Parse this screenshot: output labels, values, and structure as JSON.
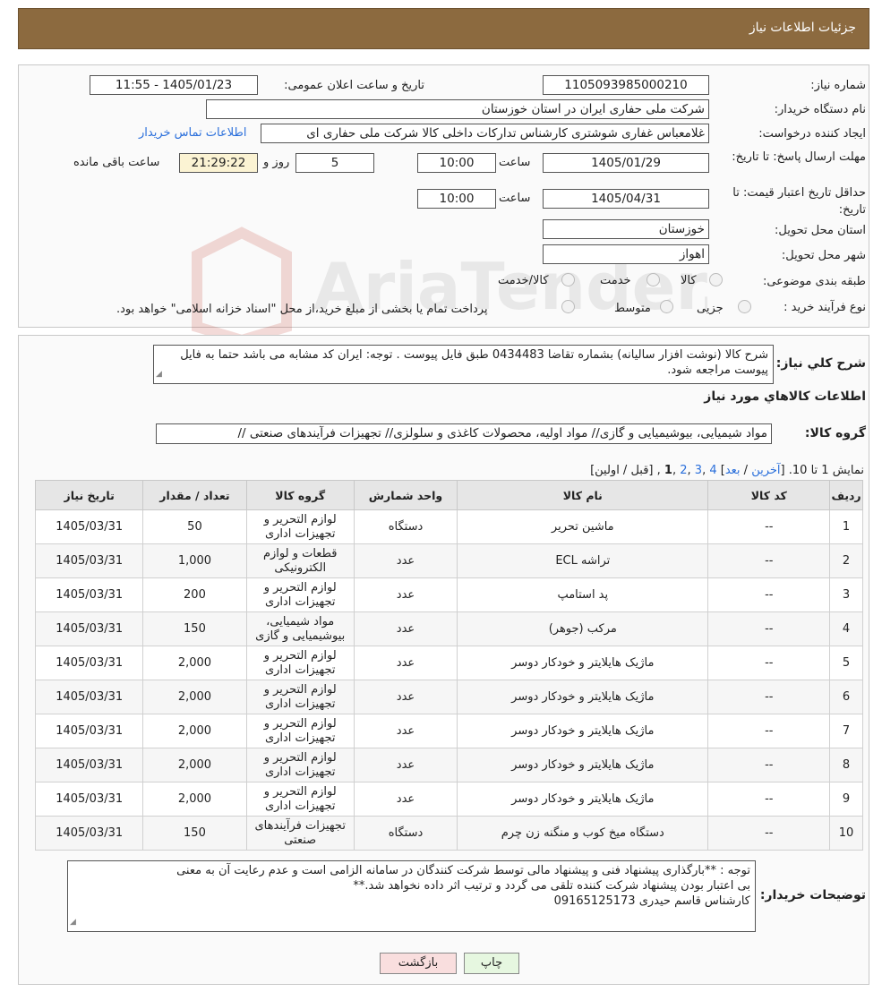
{
  "header": {
    "title": "جزئیات اطلاعات نیاز"
  },
  "need": {
    "number_label": "شماره نیاز:",
    "number": "1105093985000210",
    "announce_label": "تاریخ و ساعت اعلان عمومی:",
    "announce": "1405/01/23 - 11:55",
    "buyer_label": "نام دستگاه خریدار:",
    "buyer": "شرکت ملی حفاری ایران در استان خوزستان",
    "creator_label": "ایجاد کننده درخواست:",
    "creator": "غلامعباس غفاری شوشتری کارشناس تدارکات داخلی کالا شرکت ملی حفاری ای",
    "contact_link": "اطلاعات تماس خریدار",
    "deadline_label": "مهلت ارسال پاسخ: تا تاریخ:",
    "deadline_date": "1405/01/29",
    "time_label": "ساعت",
    "deadline_time": "10:00",
    "days": "5",
    "days_label": "روز و",
    "remaining": "21:29:22",
    "remaining_label": "ساعت باقی مانده",
    "validity_label": "حداقل تاریخ اعتبار قیمت: تا تاریخ:",
    "validity_date": "1405/04/31",
    "validity_time": "10:00",
    "province_label": "استان محل تحویل:",
    "province": "خوزستان",
    "city_label": "شهر محل تحویل:",
    "city": "اهواز",
    "category_label": "طبقه بندی موضوعی:",
    "cat_options": [
      "کالا",
      "خدمت",
      "کالا/خدمت"
    ],
    "process_label": "نوع فرآیند خرید :",
    "proc_options": [
      "جزیی",
      "متوسط"
    ],
    "process_note": "پرداخت تمام یا بخشی از مبلغ خرید،از محل \"اسناد خزانه اسلامی\" خواهد بود."
  },
  "summary": {
    "label": "شرح کلي نیاز:",
    "text": "شرح کالا (نوشت افزار سالیانه) بشماره تقاضا 0434483 طبق فایل پیوست . توجه: ایران کد مشابه می باشد حتما به فایل پیوست مراجعه شود."
  },
  "goods": {
    "title": "اطلاعات کالاهاي مورد نیاز",
    "group_label": "گروه کالا:",
    "group": "مواد شیمیایی، بیوشیمیایی و  گازی// مواد اولیه، محصولات کاغذی و سلولزی// تجهیزات فرآیندهای صنعتی //"
  },
  "pagination": {
    "showing": "نمایش 1 تا 10.",
    "open": "[",
    "last": "آخرین",
    "sep1": " / ",
    "next": "بعد",
    "close1": "]",
    "p4": "4",
    "p3": "3",
    "p2": "2",
    "p1": "1",
    "prev_first": "[قبل / اولین]",
    "c1": " ,",
    "c2": " ,",
    "c3": " ,",
    "c4": " ,"
  },
  "table": {
    "headers": [
      "ردیف",
      "کد کالا",
      "نام کالا",
      "واحد شمارش",
      "گروه کالا",
      "تعداد / مقدار",
      "تاریخ نیاز"
    ],
    "rows": [
      [
        "1",
        "--",
        "ماشین تحریر",
        "دستگاه",
        "لوازم التحریر و تجهیزات اداری",
        "50",
        "1405/03/31"
      ],
      [
        "2",
        "--",
        "تراشه ECL",
        "عدد",
        "قطعات و لوازم الکترونیکی",
        "1,000",
        "1405/03/31"
      ],
      [
        "3",
        "--",
        "پد استامپ",
        "عدد",
        "لوازم التحریر و تجهیزات اداری",
        "200",
        "1405/03/31"
      ],
      [
        "4",
        "--",
        "مرکب (جوهر)",
        "عدد",
        "مواد شیمیایی، بیوشیمیایی و گازی",
        "150",
        "1405/03/31"
      ],
      [
        "5",
        "--",
        "ماژیک هایلایتر و خودکار دوسر",
        "عدد",
        "لوازم التحریر و تجهیزات اداری",
        "2,000",
        "1405/03/31"
      ],
      [
        "6",
        "--",
        "ماژیک هایلایتر و خودکار دوسر",
        "عدد",
        "لوازم التحریر و تجهیزات اداری",
        "2,000",
        "1405/03/31"
      ],
      [
        "7",
        "--",
        "ماژیک هایلایتر و خودکار دوسر",
        "عدد",
        "لوازم التحریر و تجهیزات اداری",
        "2,000",
        "1405/03/31"
      ],
      [
        "8",
        "--",
        "ماژیک هایلایتر و خودکار دوسر",
        "عدد",
        "لوازم التحریر و تجهیزات اداری",
        "2,000",
        "1405/03/31"
      ],
      [
        "9",
        "--",
        "ماژیک هایلایتر و خودکار دوسر",
        "عدد",
        "لوازم التحریر و تجهیزات اداری",
        "2,000",
        "1405/03/31"
      ],
      [
        "10",
        "--",
        "دستگاه میخ کوب و منگنه زن چرم",
        "دستگاه",
        "تجهیزات فرآیندهای صنعتی",
        "150",
        "1405/03/31"
      ]
    ]
  },
  "notes": {
    "label": "توضیحات خریدار:",
    "line1": "توجه : **بارگذاری پیشنهاد فنی و پیشنهاد مالی توسط شرکت کنندگان در سامانه الزامی است و  عدم رعایت آن به معنی",
    "line2": "بی اعتبار بودن پیشنهاد شرکت کننده تلقی می گردد و ترتیب اثر داده نخواهد شد.**",
    "line3": "کارشناس قاسم حیدری 09165125173"
  },
  "buttons": {
    "print": "چاپ",
    "back": "بازگشت"
  },
  "watermark": {
    "text": "AriaTender.neT"
  },
  "colors": {
    "header": "#8c6a3f",
    "link": "#2a6fdb",
    "back_btn": "#f9dede",
    "print_btn": "#e6f7e0"
  }
}
